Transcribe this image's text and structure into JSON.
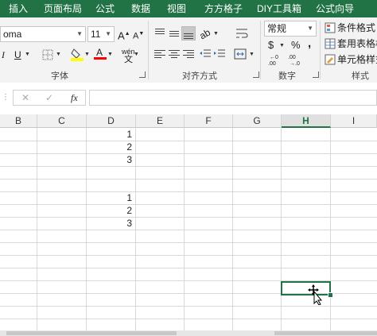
{
  "ribbon_tabs": [
    "插入",
    "页面布局",
    "公式",
    "数据",
    "视图",
    "方方格子",
    "DIY工具箱",
    "公式向导"
  ],
  "font": {
    "name": "oma",
    "size": "11",
    "bold": "I",
    "underline": "U",
    "font_color_letter": "A",
    "phonetic": "wén",
    "group_label": "字体"
  },
  "alignment": {
    "group_label": "对齐方式"
  },
  "number": {
    "format": "常规",
    "currency": "$",
    "percent": "%",
    "comma": ",",
    "group_label": "数字"
  },
  "styles": {
    "conditional_format": "条件格式",
    "table_format": "套用表格格",
    "cell_styles": "单元格样式",
    "group_label": "样式"
  },
  "formula_bar": {
    "cancel": "✕",
    "enter": "✓",
    "fx": "fx",
    "content": ""
  },
  "columns": [
    "B",
    "C",
    "D",
    "E",
    "F",
    "G",
    "H",
    "I"
  ],
  "selected_column": "H",
  "cells": [
    {
      "col": "D",
      "row": 1,
      "value": "1"
    },
    {
      "col": "D",
      "row": 2,
      "value": "2"
    },
    {
      "col": "D",
      "row": 3,
      "value": "3"
    },
    {
      "col": "D",
      "row": 6,
      "value": "1"
    },
    {
      "col": "D",
      "row": 7,
      "value": "2"
    },
    {
      "col": "D",
      "row": 8,
      "value": "3"
    }
  ],
  "icons": {
    "font_size_up": "A▲",
    "font_size_down": "A▼",
    "border": "border-icon",
    "fill": "fill-color-icon",
    "wrap": "wrap-text-icon",
    "merge": "merge-icon",
    "cursor": "move-cursor-icon"
  },
  "colors": {
    "accent": "#217346",
    "fill_highlight": "#ffff00",
    "font_red": "#ff0000"
  }
}
